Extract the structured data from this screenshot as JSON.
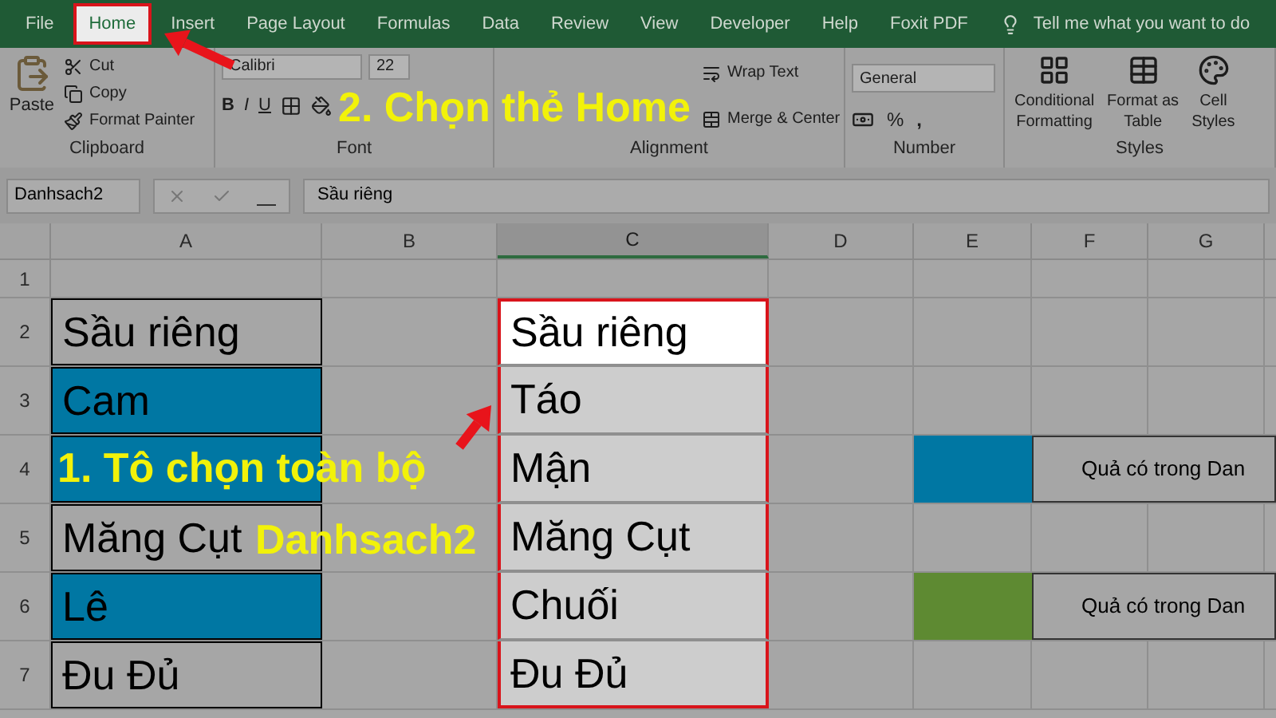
{
  "ribbon_tabs": [
    {
      "label": "File",
      "selected": false
    },
    {
      "label": "Home",
      "selected": true
    },
    {
      "label": "Insert",
      "selected": false
    },
    {
      "label": "Page Layout",
      "selected": false
    },
    {
      "label": "Formulas",
      "selected": false
    },
    {
      "label": "Data",
      "selected": false
    },
    {
      "label": "Review",
      "selected": false
    },
    {
      "label": "View",
      "selected": false
    },
    {
      "label": "Developer",
      "selected": false
    },
    {
      "label": "Help",
      "selected": false
    },
    {
      "label": "Foxit PDF",
      "selected": false
    }
  ],
  "tell_me": "Tell me what you want to do",
  "clipboard": {
    "paste": "Paste",
    "cut": "Cut",
    "copy": "Copy",
    "format_painter": "Format Painter",
    "label": "Clipboard"
  },
  "font": {
    "name": "Calibri",
    "size": "22",
    "bold": "B",
    "italic": "I",
    "underline": "U",
    "label": "Font"
  },
  "alignment": {
    "wrap_text": "Wrap Text",
    "merge_center": "Merge & Center",
    "label": "Alignment"
  },
  "number": {
    "format": "General",
    "percent": "%",
    "comma": ",",
    "label": "Number"
  },
  "styles": {
    "items": [
      [
        "Conditional",
        "Formatting"
      ],
      [
        "Format as",
        "Table"
      ],
      [
        "Cell",
        "Styles"
      ]
    ],
    "label": "Styles"
  },
  "name_box": "Danhsach2",
  "formula": "Sầu riêng",
  "columns": [
    {
      "label": "A",
      "selected": false
    },
    {
      "label": "B",
      "selected": false
    },
    {
      "label": "C",
      "selected": true
    },
    {
      "label": "D",
      "selected": false
    },
    {
      "label": "E",
      "selected": false
    },
    {
      "label": "F",
      "selected": false
    },
    {
      "label": "G",
      "selected": false
    }
  ],
  "rows": [
    {
      "number": "1"
    },
    {
      "number": "2",
      "a": {
        "text": "Sầu riêng"
      },
      "c": {
        "text": "Sầu riêng",
        "active": true
      }
    },
    {
      "number": "3",
      "a": {
        "text": "Cam",
        "color": "#0077a3"
      },
      "c": {
        "text": "Táo",
        "active": false
      }
    },
    {
      "number": "4",
      "a": {
        "color": "#0077a3"
      },
      "c": {
        "text": "Mận",
        "active": false
      },
      "legend": {
        "color": "#0077a3",
        "text": "Quả có trong Dan"
      }
    },
    {
      "number": "5",
      "a": {
        "text": "Măng Cụt"
      },
      "c": {
        "text": "Măng Cụt",
        "active": false
      }
    },
    {
      "number": "6",
      "a": {
        "text": "Lê",
        "color": "#0077a3"
      },
      "c": {
        "text": "Chuối",
        "active": false
      },
      "legend": {
        "color": "#5e8a32",
        "text": "Quả có trong Dan"
      }
    },
    {
      "number": "7",
      "a": {
        "text": "Đu Đủ"
      },
      "c": {
        "text": "Đu Đủ",
        "active": false
      }
    }
  ],
  "annotations": [
    {
      "kind": "callout",
      "lines": [
        "1. Tô chọn toàn bộ",
        "Danhsach2"
      ]
    },
    {
      "kind": "callout",
      "lines": [
        "2. Chọn thẻ Home"
      ]
    }
  ]
}
